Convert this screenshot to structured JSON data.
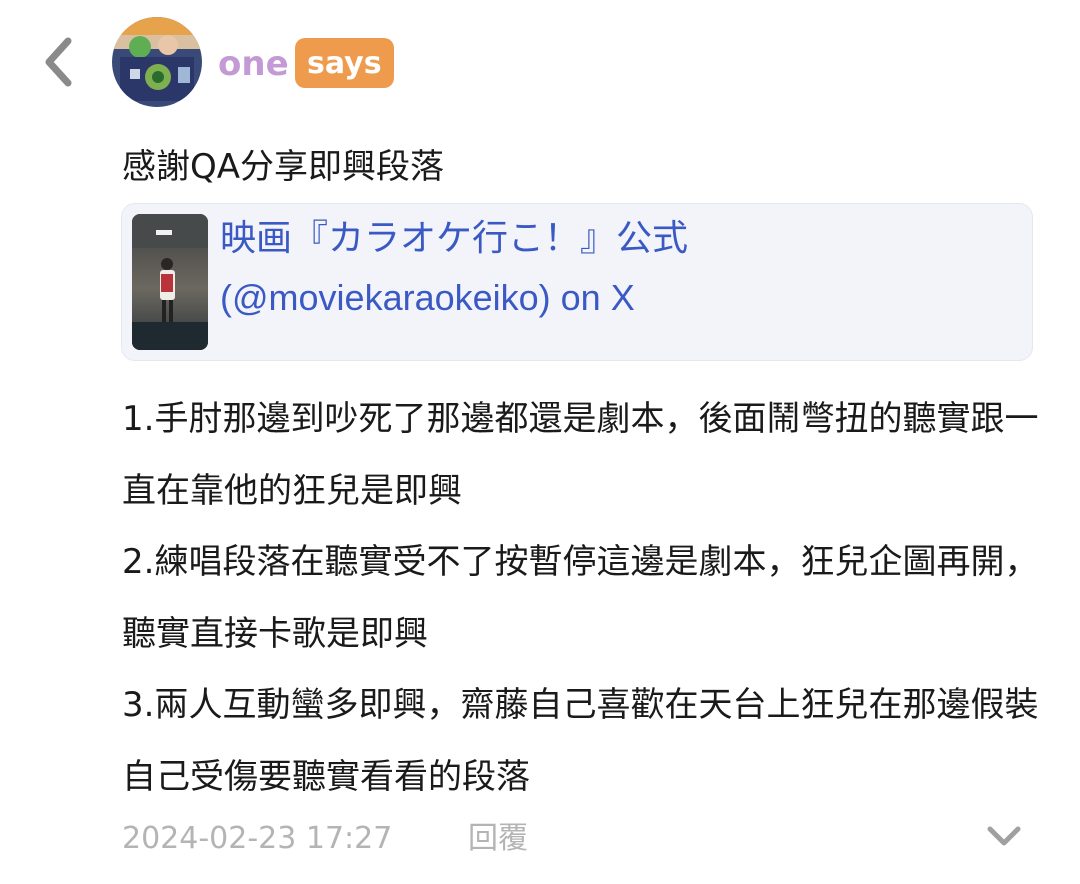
{
  "header": {
    "username": "one",
    "badge": "says"
  },
  "post": {
    "intro": "感謝QA分享即興段落",
    "link_card": {
      "title": "映画『カラオケ行こ！』公式 (@moviekaraokeiko) on X"
    },
    "paragraphs": [
      "1.手肘那邊到吵死了那邊都還是劇本，後面鬧彆扭的聽實跟一直在靠他的狂兒是即興",
      "2.練唱段落在聽實受不了按暫停這邊是劇本，狂兒企圖再開，聽實直接卡歌是即興",
      "3.兩人互動蠻多即興，齋藤自己喜歡在天台上狂兒在那邊假裝自己受傷要聽實看看的段落"
    ],
    "timestamp": "2024-02-23 17:27",
    "reply_label": "回覆"
  },
  "colors": {
    "username": "#c49ad6",
    "badge_bg": "#ef9b4d",
    "link": "#3a59c4",
    "muted": "#b4b4b4",
    "card_bg": "#f3f4fa"
  },
  "icons": {
    "back": "chevron-left-icon",
    "expand": "chevron-down-icon"
  }
}
